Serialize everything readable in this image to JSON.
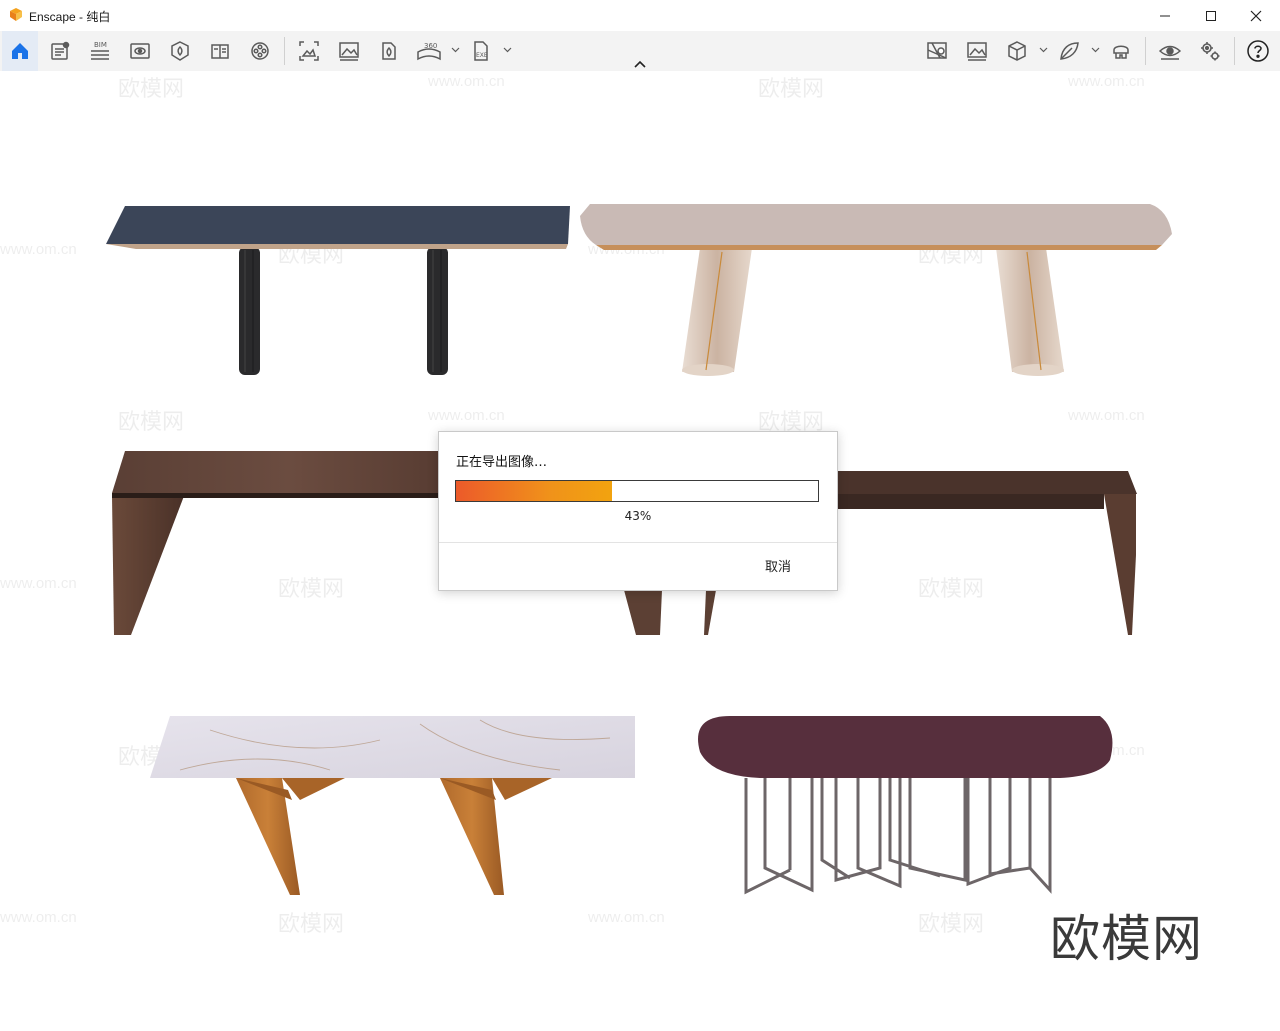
{
  "window": {
    "title": "Enscape - 纯白",
    "controls": [
      "minimize-icon",
      "maximize-icon",
      "close-icon"
    ]
  },
  "toolbar": {
    "left_groups": [
      [
        "home-icon",
        "notes-icon",
        "bim-icon",
        "views-icon",
        "site-context-icon",
        "book-icon",
        "video-reel-icon"
      ],
      [
        "screenshot-icon",
        "image-icon",
        "batch-render-icon",
        "panorama-360-icon",
        "exe-export-icon"
      ]
    ],
    "bim_label": "BIM",
    "pano_label": "360",
    "exe_label": "EXE",
    "right_icons": [
      "map-pin-icon",
      "image-gallery-icon",
      "cube-icon",
      "leaf-icon",
      "vr-headset-icon",
      "eye-icon",
      "settings-gears-icon",
      "help-icon"
    ],
    "collapse_icon": "chevron-up-icon"
  },
  "dialog": {
    "title": "正在导出图像…",
    "progress_percent": 43,
    "progress_text": "43%",
    "cancel_label": "取消"
  },
  "watermark": {
    "brand": "欧模网",
    "url": "www.om.cn"
  },
  "colors": {
    "accent": "#1a73e8",
    "progress_start": "#ec5a2a",
    "progress_end": "#f2a30f",
    "toolbar_bg": "#f3f3f3",
    "icon": "#5a5a5a"
  }
}
